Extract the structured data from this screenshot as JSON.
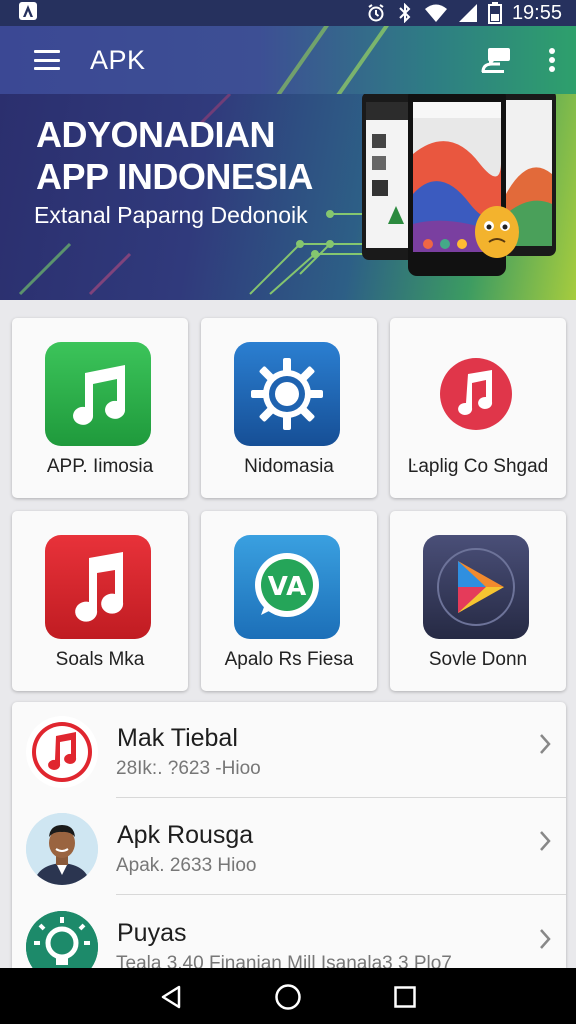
{
  "status_bar": {
    "time": "19:55",
    "icons": [
      "notification-icon",
      "alarm-icon",
      "bluetooth-icon",
      "wifi-icon",
      "signal-icon",
      "battery-icon"
    ]
  },
  "app_bar": {
    "title": "APK",
    "icons": [
      "menu-icon",
      "chat-icon",
      "more-vert-icon"
    ]
  },
  "banner": {
    "title_line1": "ADYONADIAN",
    "title_line2": "APP INDONESIA",
    "subtitle": "Extanal Paparng Dedonoik"
  },
  "grid": {
    "apps": [
      {
        "label": "APP. Iimosia",
        "icon": "music-note-icon",
        "color": "#2fb24c"
      },
      {
        "label": "Nidomasia",
        "icon": "gear-icon",
        "color": "#1f63b0"
      },
      {
        "label": "Ŀaplig Co Shgad",
        "icon": "music-note-icon",
        "color": "#e0364a"
      },
      {
        "label": "Soals Mka",
        "icon": "music-note-icon",
        "color": "#d7262a"
      },
      {
        "label": "Apalo Rs Fiesa",
        "icon": "whatsapp-icon",
        "color": "#2a8bd0"
      },
      {
        "label": "Sovle Donn",
        "icon": "play-icon",
        "color": "#3a3f63"
      }
    ]
  },
  "list": {
    "items": [
      {
        "title": "Mak Tiebal",
        "subtitle": "28Ik:. ?623 -Hioo",
        "icon": "music-note-icon"
      },
      {
        "title": "Apk Rousga",
        "subtitle": "Apak. 2633 Hioo",
        "icon": "avatar-icon"
      },
      {
        "title": "Puyas",
        "subtitle": "Teala 3.40 Finanian Mill Isanala3 3 Plo7",
        "icon": "lightbulb-icon"
      }
    ]
  },
  "nav_bar": {
    "icons": [
      "back-icon",
      "home-icon",
      "recents-icon"
    ]
  },
  "colors": {
    "status_bar": "#26315e",
    "app_bar_start": "#3b4894",
    "app_bar_end": "#2ea06c"
  }
}
